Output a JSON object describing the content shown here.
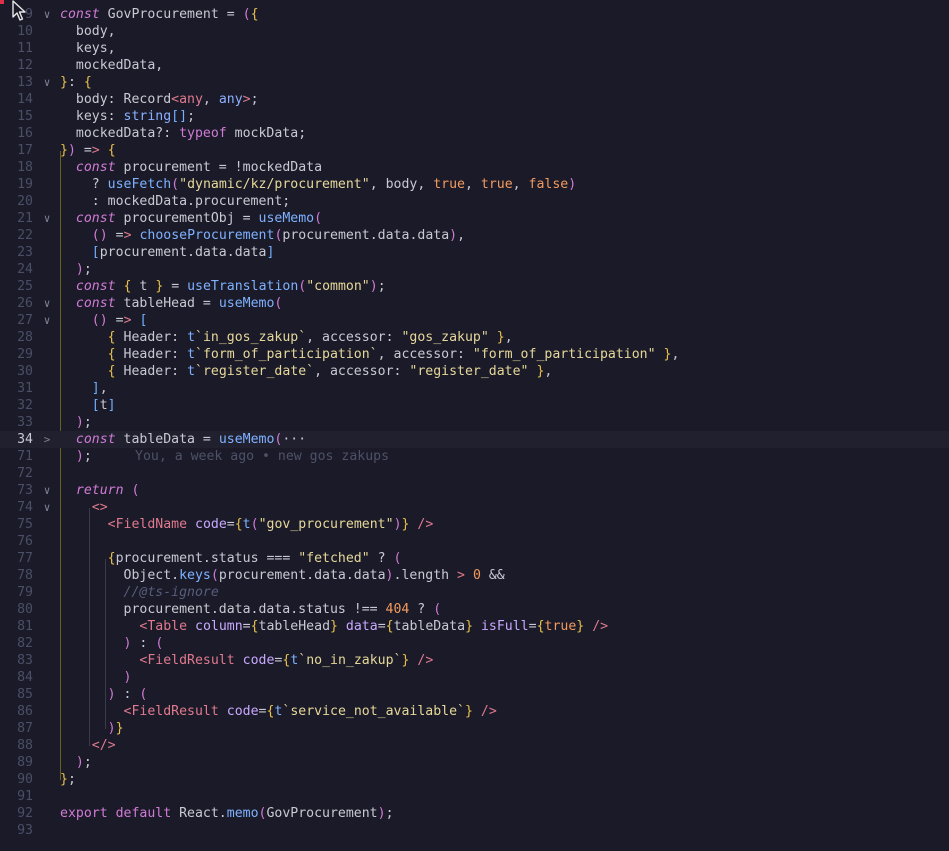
{
  "editor": {
    "lines": [
      {
        "n": "10",
        "text": "  body,"
      },
      {
        "n": "11",
        "text": "  keys,"
      },
      {
        "n": "12",
        "text": "  mockedData,"
      },
      {
        "n": "13",
        "text": "}: {"
      },
      {
        "n": "14",
        "text": "  body: Record<any, any>;"
      },
      {
        "n": "15",
        "text": "  keys: string[];"
      },
      {
        "n": "16",
        "text": "  mockedData?: typeof mockData;"
      },
      {
        "n": "17",
        "text": "}) => {"
      },
      {
        "n": "18",
        "text": "  const procurement = !mockedData"
      },
      {
        "n": "19",
        "text": "    ? useFetch(\"dynamic/kz/procurement\", body, true, true, false)"
      },
      {
        "n": "20",
        "text": "    : mockedData.procurement;"
      },
      {
        "n": "21",
        "text": "  const procurementObj = useMemo("
      },
      {
        "n": "22",
        "text": "    () => chooseProcurement(procurement.data.data),"
      },
      {
        "n": "23",
        "text": "    [procurement.data.data]"
      },
      {
        "n": "24",
        "text": "  );"
      },
      {
        "n": "25",
        "text": "  const { t } = useTranslation(\"common\");"
      },
      {
        "n": "26",
        "text": "  const tableHead = useMemo("
      },
      {
        "n": "27",
        "text": "    () => ["
      },
      {
        "n": "28",
        "text": "      { Header: t`in_gos_zakup`, accessor: \"gos_zakup\" },"
      },
      {
        "n": "29",
        "text": "      { Header: t`form_of_participation`, accessor: \"form_of_participation\" },"
      },
      {
        "n": "30",
        "text": "      { Header: t`register_date`, accessor: \"register_date\" },"
      },
      {
        "n": "31",
        "text": "    ],"
      },
      {
        "n": "32",
        "text": "    [t]"
      },
      {
        "n": "33",
        "text": "  );"
      },
      {
        "n": "34",
        "text": "  const tableData = useMemo(···"
      },
      {
        "n": "71",
        "text": "  );"
      },
      {
        "n": "72",
        "text": ""
      },
      {
        "n": "73",
        "text": "  return ("
      },
      {
        "n": "74",
        "text": "    <>"
      },
      {
        "n": "75",
        "text": "      <FieldName code={t(\"gov_procurement\")} />"
      },
      {
        "n": "76",
        "text": ""
      },
      {
        "n": "77",
        "text": "      {procurement.status === \"fetched\" ? ("
      },
      {
        "n": "78",
        "text": "        Object.keys(procurement.data.data).length > 0 &&"
      },
      {
        "n": "79",
        "text": "        //@ts-ignore"
      },
      {
        "n": "80",
        "text": "        procurement.data.data.status !== 404 ? ("
      },
      {
        "n": "81",
        "text": "          <Table column={tableHead} data={tableData} isFull={true} />"
      },
      {
        "n": "82",
        "text": "        ) : ("
      },
      {
        "n": "83",
        "text": "          <FieldResult code={t`no_in_zakup`} />"
      },
      {
        "n": "84",
        "text": "        )"
      },
      {
        "n": "85",
        "text": "      ) : ("
      },
      {
        "n": "86",
        "text": "        <FieldResult code={t`service_not_available`} />"
      },
      {
        "n": "87",
        "text": "      )}"
      },
      {
        "n": "88",
        "text": "    </>"
      },
      {
        "n": "89",
        "text": "  );"
      },
      {
        "n": "90",
        "text": "};"
      },
      {
        "n": "91",
        "text": ""
      },
      {
        "n": "92",
        "text": "export default React.memo(GovProcurement);"
      },
      {
        "n": "93",
        "text": ""
      }
    ],
    "first_line": {
      "n": "9",
      "text": "const GovProcurement = ({"
    },
    "blame": "You, a week ago • new gos zakups",
    "fold_open": "∨",
    "fold_closed": ">"
  },
  "colors": {
    "background": "#1a1a28",
    "keyword": "#d17bd5",
    "string": "#e6d89a",
    "function": "#7fb1ff",
    "boolean": "#f39a5e",
    "tag": "#e07a8e",
    "comment": "#575d7a"
  }
}
